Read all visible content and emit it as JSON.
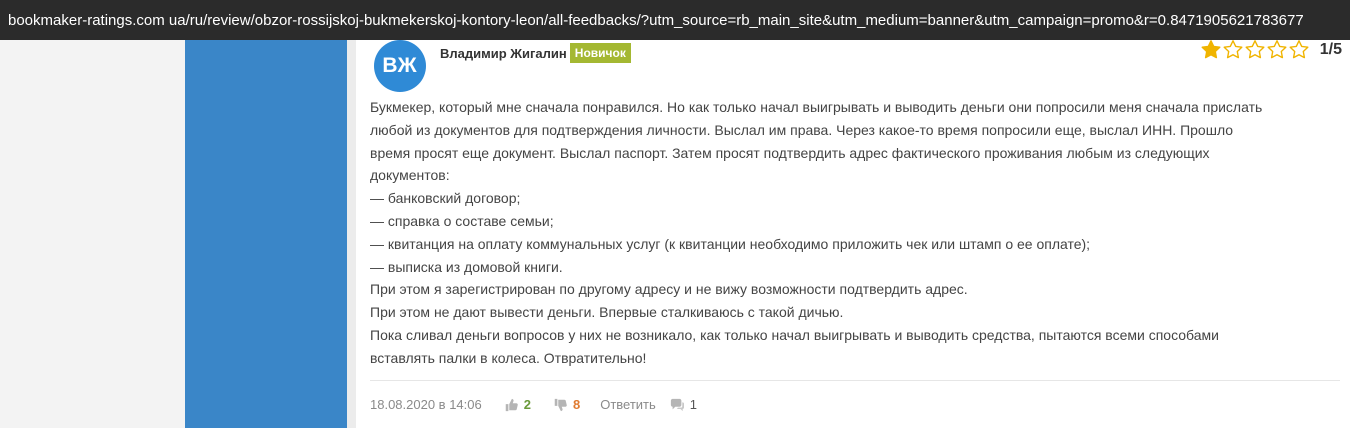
{
  "address_bar": {
    "url": "bookmaker-ratings.com ua/ru/review/obzor-rossijskoj-bukmekerskoj-kontory-leon/all-feedbacks/?utm_source=rb_main_site&utm_medium=banner&utm_campaign=promo&r=0.8471905621783677"
  },
  "review": {
    "avatar_initials": "ВЖ",
    "author_name": "Владимир Жигалин",
    "author_badge": "Новичок",
    "rating": {
      "value": 1,
      "max": 5,
      "display": "1/5"
    },
    "body_lines": [
      "Букмекер, который мне сначала понравился. Но как только начал выигрывать и выводить деньги они попросили меня сначала прислать",
      "любой из документов для подтверждения личности. Выслал им права. Через какое-то время попросили еще, выслал ИНН. Прошло",
      "время просят еще документ. Выслал паспорт. Затем просят подтвердить адрес фактического проживания любым из следующих",
      "документов:",
      "— банковский договор;",
      "— справка о составе семьи;",
      "— квитанция на оплату коммунальных услуг (к квитанции необходимо приложить чек или штамп о ее оплате);",
      "— выписка из домовой книги.",
      "При этом я зарегистрирован по другому адресу и не вижу возможности подтвердить адрес.",
      "При этом не дают вывести деньги. Впервые сталкиваюсь с такой дичью.",
      "Пока сливал деньги вопросов у них не возникало, как только начал выигрывать и выводить средства, пытаются всеми способами",
      "вставлять палки в колеса. Отвратительно!"
    ],
    "date": "18.08.2020 в 14:06",
    "likes": "2",
    "dislikes": "8",
    "reply_label": "Ответить",
    "comments_count": "1"
  },
  "colors": {
    "accent_blue": "#3a86c8",
    "badge_green": "#a4b832",
    "star_gold": "#f0b400",
    "likes_green": "#6a9a3a",
    "dislikes_orange": "#e07a30"
  },
  "icons": [
    "star-filled-icon",
    "star-empty-icon",
    "thumbs-up-icon",
    "thumbs-down-icon",
    "comment-bubble-icon"
  ]
}
